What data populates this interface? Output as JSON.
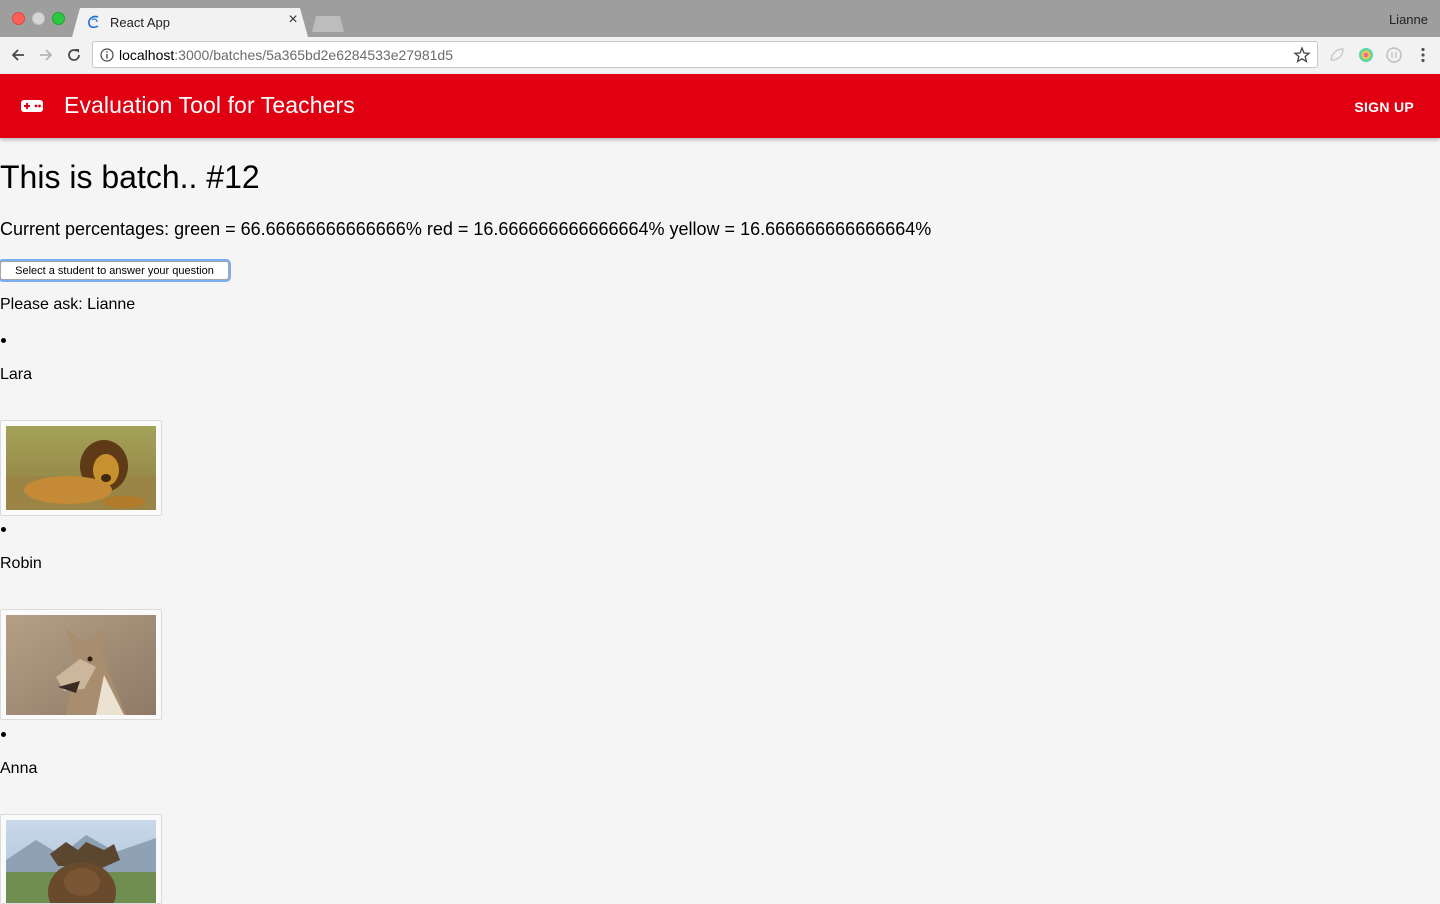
{
  "browser": {
    "tab_title": "React App",
    "profile_name": "Lianne",
    "url_host": "localhost",
    "url_path": ":3000/batches/5a365bd2e6284533e27981d5"
  },
  "appbar": {
    "title": "Evaluation Tool for Teachers",
    "signup_label": "SIGN UP",
    "color": "#e10012",
    "icon": "gamepad-icon"
  },
  "page": {
    "title": "This is batch.. #12",
    "percentages": "Current percentages: green = 66.66666666666666% red = 16.666666666666664% yellow = 16.666666666666664%",
    "select_button_label": "Select a student to answer your question",
    "ask_text": "Please ask: Lianne"
  },
  "students": [
    {
      "name": "Lara",
      "photo": "lion"
    },
    {
      "name": "Robin",
      "photo": "coyote"
    },
    {
      "name": "Anna",
      "photo": "moose"
    }
  ]
}
